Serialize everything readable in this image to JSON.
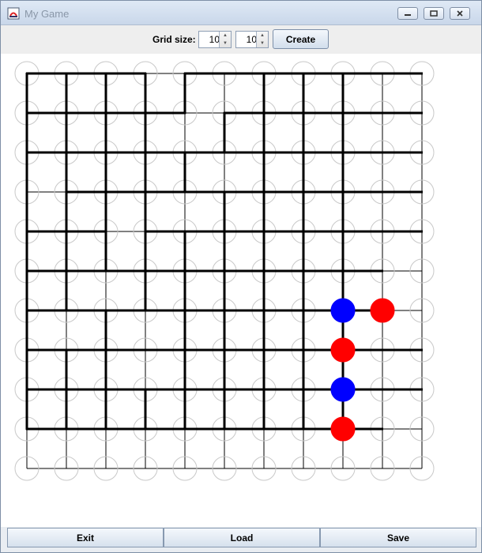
{
  "window": {
    "title": "My Game"
  },
  "toolbar": {
    "grid_size_label": "Grid size:",
    "rows": "10",
    "cols": "10",
    "create_label": "Create"
  },
  "buttons": {
    "exit": "Exit",
    "load": "Load",
    "save": "Save"
  },
  "board": {
    "rows": 10,
    "cols": 10,
    "thick_horizontal": [
      [
        0,
        0
      ],
      [
        0,
        1
      ],
      [
        0,
        2
      ],
      [
        0,
        4
      ],
      [
        0,
        5
      ],
      [
        0,
        6
      ],
      [
        0,
        7
      ],
      [
        0,
        8
      ],
      [
        0,
        9
      ],
      [
        1,
        0
      ],
      [
        1,
        1
      ],
      [
        1,
        2
      ],
      [
        1,
        3
      ],
      [
        1,
        5
      ],
      [
        1,
        6
      ],
      [
        1,
        7
      ],
      [
        1,
        8
      ],
      [
        1,
        9
      ],
      [
        2,
        0
      ],
      [
        2,
        1
      ],
      [
        2,
        2
      ],
      [
        2,
        3
      ],
      [
        2,
        4
      ],
      [
        2,
        5
      ],
      [
        2,
        6
      ],
      [
        2,
        7
      ],
      [
        2,
        8
      ],
      [
        2,
        9
      ],
      [
        3,
        1
      ],
      [
        3,
        2
      ],
      [
        3,
        3
      ],
      [
        3,
        4
      ],
      [
        3,
        5
      ],
      [
        3,
        6
      ],
      [
        3,
        7
      ],
      [
        3,
        8
      ],
      [
        3,
        9
      ],
      [
        4,
        0
      ],
      [
        4,
        1
      ],
      [
        4,
        3
      ],
      [
        4,
        4
      ],
      [
        4,
        5
      ],
      [
        4,
        6
      ],
      [
        4,
        7
      ],
      [
        4,
        8
      ],
      [
        4,
        9
      ],
      [
        5,
        0
      ],
      [
        5,
        1
      ],
      [
        5,
        2
      ],
      [
        5,
        3
      ],
      [
        5,
        4
      ],
      [
        5,
        5
      ],
      [
        5,
        6
      ],
      [
        5,
        7
      ],
      [
        5,
        8
      ],
      [
        6,
        0
      ],
      [
        6,
        1
      ],
      [
        6,
        2
      ],
      [
        6,
        3
      ],
      [
        6,
        4
      ],
      [
        6,
        5
      ],
      [
        6,
        6
      ],
      [
        6,
        7
      ],
      [
        6,
        8
      ],
      [
        7,
        0
      ],
      [
        7,
        1
      ],
      [
        7,
        2
      ],
      [
        7,
        3
      ],
      [
        7,
        4
      ],
      [
        7,
        5
      ],
      [
        7,
        6
      ],
      [
        7,
        7
      ],
      [
        7,
        8
      ],
      [
        7,
        9
      ],
      [
        8,
        0
      ],
      [
        8,
        1
      ],
      [
        8,
        2
      ],
      [
        8,
        3
      ],
      [
        8,
        4
      ],
      [
        8,
        5
      ],
      [
        8,
        6
      ],
      [
        8,
        7
      ],
      [
        8,
        8
      ],
      [
        8,
        9
      ],
      [
        9,
        0
      ],
      [
        9,
        1
      ],
      [
        9,
        2
      ],
      [
        9,
        3
      ],
      [
        9,
        4
      ],
      [
        9,
        5
      ],
      [
        9,
        6
      ],
      [
        9,
        7
      ],
      [
        9,
        8
      ]
    ],
    "thick_vertical": [
      [
        0,
        0
      ],
      [
        0,
        1
      ],
      [
        0,
        2
      ],
      [
        0,
        3
      ],
      [
        0,
        4
      ],
      [
        0,
        6
      ],
      [
        0,
        7
      ],
      [
        0,
        8
      ],
      [
        1,
        0
      ],
      [
        1,
        1
      ],
      [
        1,
        2
      ],
      [
        1,
        3
      ],
      [
        1,
        5
      ],
      [
        1,
        6
      ],
      [
        1,
        7
      ],
      [
        1,
        8
      ],
      [
        2,
        0
      ],
      [
        2,
        1
      ],
      [
        2,
        2
      ],
      [
        2,
        3
      ],
      [
        2,
        4
      ],
      [
        2,
        6
      ],
      [
        2,
        7
      ],
      [
        2,
        8
      ],
      [
        3,
        0
      ],
      [
        3,
        1
      ],
      [
        3,
        2
      ],
      [
        3,
        3
      ],
      [
        3,
        5
      ],
      [
        3,
        6
      ],
      [
        3,
        7
      ],
      [
        3,
        8
      ],
      [
        4,
        0
      ],
      [
        4,
        1
      ],
      [
        4,
        2
      ],
      [
        4,
        3
      ],
      [
        4,
        4
      ],
      [
        4,
        5
      ],
      [
        4,
        6
      ],
      [
        4,
        7
      ],
      [
        4,
        8
      ],
      [
        5,
        0
      ],
      [
        5,
        1
      ],
      [
        5,
        3
      ],
      [
        5,
        4
      ],
      [
        5,
        5
      ],
      [
        5,
        6
      ],
      [
        5,
        7
      ],
      [
        5,
        8
      ],
      [
        6,
        0
      ],
      [
        6,
        2
      ],
      [
        6,
        4
      ],
      [
        6,
        5
      ],
      [
        6,
        6
      ],
      [
        6,
        7
      ],
      [
        6,
        8
      ],
      [
        7,
        0
      ],
      [
        7,
        1
      ],
      [
        7,
        2
      ],
      [
        7,
        4
      ],
      [
        7,
        5
      ],
      [
        7,
        6
      ],
      [
        7,
        7
      ],
      [
        7,
        8
      ],
      [
        8,
        0
      ],
      [
        8,
        1
      ],
      [
        8,
        2
      ],
      [
        8,
        3
      ],
      [
        8,
        4
      ],
      [
        8,
        5
      ],
      [
        8,
        6
      ],
      [
        8,
        7
      ],
      [
        8,
        8
      ]
    ],
    "pieces": [
      {
        "row": 6,
        "col": 8,
        "color": "#0000ff"
      },
      {
        "row": 6,
        "col": 9,
        "color": "#ff0000"
      },
      {
        "row": 7,
        "col": 8,
        "color": "#ff0000"
      },
      {
        "row": 8,
        "col": 8,
        "color": "#0000ff"
      },
      {
        "row": 9,
        "col": 8,
        "color": "#ff0000"
      }
    ]
  }
}
